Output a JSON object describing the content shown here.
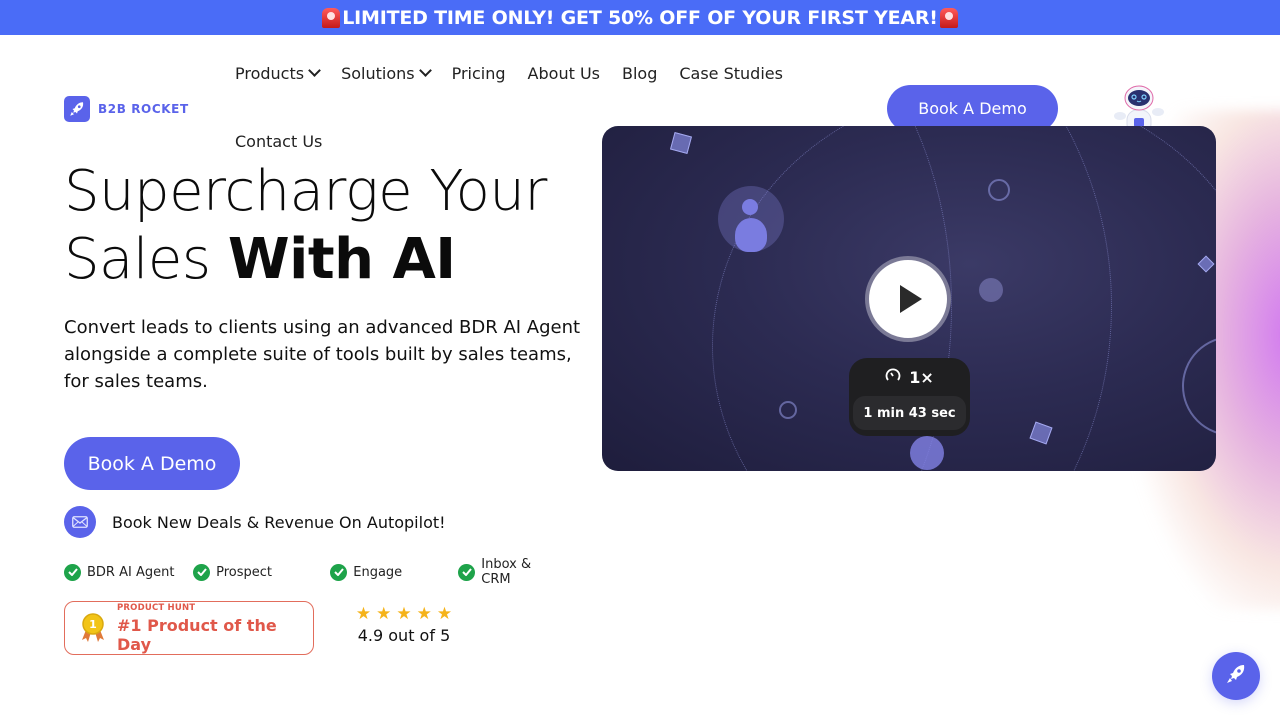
{
  "banner": {
    "text": "LIMITED TIME ONLY! GET 50% OFF OF YOUR FIRST YEAR!",
    "left_icon": "siren-icon",
    "right_icon": "siren-icon",
    "background": "#4a6cf7"
  },
  "brand": {
    "name": "B2B ROCKET",
    "logo_icon": "rocket-icon",
    "color": "#5a63ea"
  },
  "nav": {
    "items": [
      {
        "label": "Products",
        "has_dropdown": true
      },
      {
        "label": "Solutions",
        "has_dropdown": true
      },
      {
        "label": "Pricing",
        "has_dropdown": false
      },
      {
        "label": "About Us",
        "has_dropdown": false
      },
      {
        "label": "Blog",
        "has_dropdown": false
      },
      {
        "label": "Case Studies",
        "has_dropdown": false
      },
      {
        "label": "Contact Us",
        "has_dropdown": false
      }
    ],
    "cta_label": "Book A Demo"
  },
  "hero": {
    "title_line1": "Supercharge Your",
    "title_line2_light": "Sales ",
    "title_line2_bold": "With AI",
    "description": "Convert leads to clients using an advanced BDR AI Agent alongside a complete suite of tools built by sales teams, for sales teams.",
    "cta_label": "Book A Demo",
    "tagline": "Book New Deals & Revenue On Autopilot!",
    "tagline_icon": "mail-icon",
    "features": [
      {
        "label": "BDR AI Agent",
        "icon": "check-circle-icon"
      },
      {
        "label": "Prospect",
        "icon": "check-circle-icon"
      },
      {
        "label": "Engage",
        "icon": "check-circle-icon"
      },
      {
        "label": "Inbox & CRM",
        "icon": "check-circle-icon"
      }
    ]
  },
  "product_hunt": {
    "kicker": "PRODUCT HUNT",
    "title": "#1 Product of the Day",
    "medal_number": "1",
    "color": "#e0584a"
  },
  "rating": {
    "stars": 5,
    "value": 4.9,
    "max": 5,
    "text": "4.9 out of 5",
    "star_color": "#f5b31a"
  },
  "video": {
    "speed_label": "1×",
    "duration": "1 min 43 sec",
    "play_icon": "play-icon",
    "speed_icon": "speedometer-icon"
  },
  "chat_widget": {
    "icon": "rocket-icon"
  },
  "colors": {
    "accent": "#5a63ea",
    "success": "#1ea34a"
  }
}
